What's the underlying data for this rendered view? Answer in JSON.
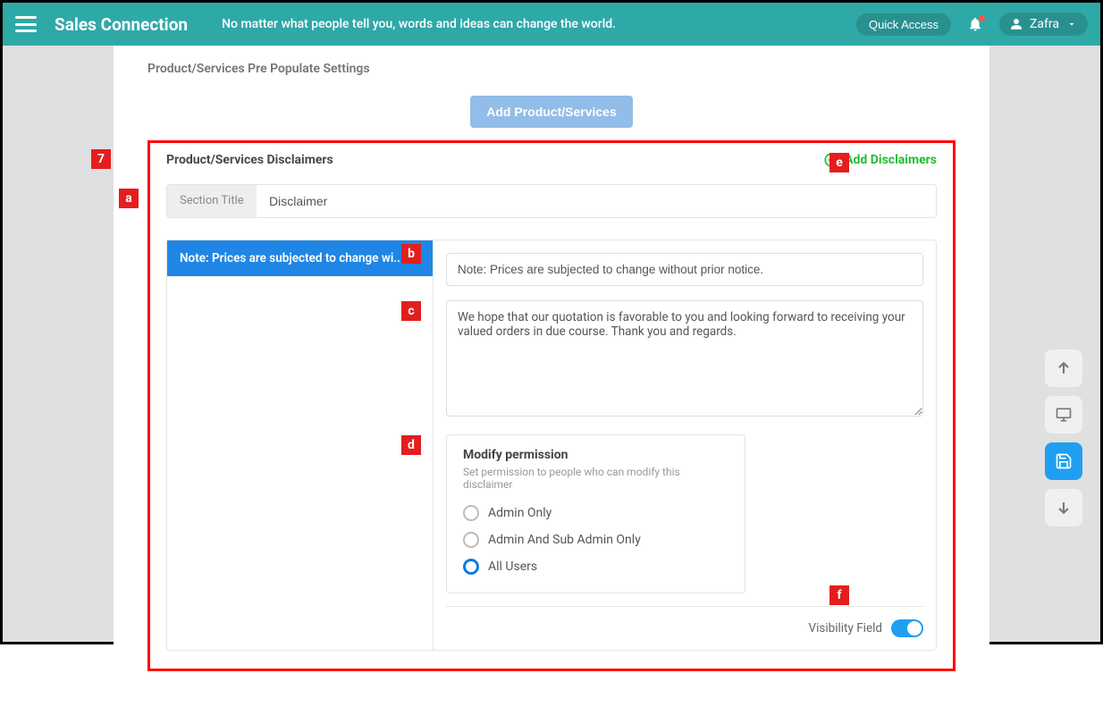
{
  "header": {
    "brand": "Sales Connection",
    "motto": "No matter what people tell you, words and ideas can change the world.",
    "quick_access": "Quick Access",
    "user_name": "Zafra"
  },
  "page": {
    "pre_populate_title": "Product/Services Pre Populate Settings",
    "add_ps_button": "Add Product/Services"
  },
  "disclaimers": {
    "section_heading": "Product/Services Disclaimers",
    "add_label": "Add Disclaimers",
    "section_title_label": "Section Title",
    "section_title_value": "Disclaimer",
    "active_tab": "Note: Prices are subjected to change wi...",
    "note_value": "Note: Prices are subjected to change without prior notice.",
    "body_text": "We hope that our quotation is favorable to you and looking forward to receiving your valued orders in due course. Thank you and regards.",
    "permissions": {
      "title": "Modify permission",
      "subtitle": "Set permission to people who can modify this disclaimer",
      "options": [
        {
          "label": "Admin Only",
          "selected": false
        },
        {
          "label": "Admin And Sub Admin Only",
          "selected": false
        },
        {
          "label": "All Users",
          "selected": true
        }
      ]
    },
    "visibility_label": "Visibility Field",
    "visibility_on": true
  },
  "annotations": {
    "7": "7",
    "a": "a",
    "b": "b",
    "c": "c",
    "d": "d",
    "e": "e",
    "f": "f"
  }
}
